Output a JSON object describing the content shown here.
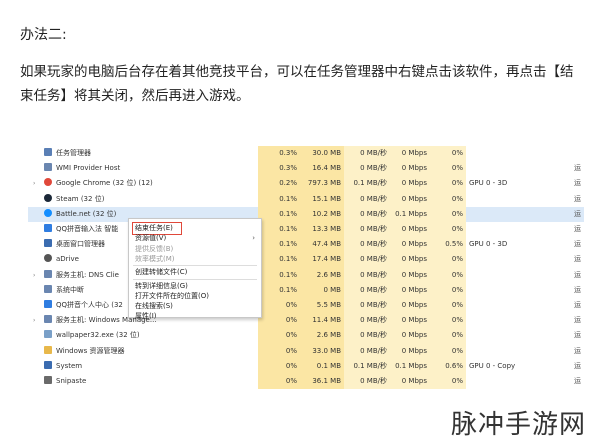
{
  "article": {
    "heading": "办法二:",
    "paragraph": "如果玩家的电脑后台存在着其他竞技平台，可以在任务管理器中右键点击该软件，再点击【结束任务】将其关闭，然后再进入游戏。"
  },
  "task_manager": {
    "rows": [
      {
        "name": "任务管理器",
        "cpu": "0.3%",
        "mem": "30.0 MB",
        "disk": "0 MB/秒",
        "net": "0 Mbps",
        "gpu": "0%",
        "engine": "",
        "tail": "",
        "icon": "gear-icon",
        "color": "#5a7fb5",
        "expand": false
      },
      {
        "name": "WMI Provider Host",
        "cpu": "0.3%",
        "mem": "16.4 MB",
        "disk": "0 MB/秒",
        "net": "0 Mbps",
        "gpu": "0%",
        "engine": "",
        "tail": "运",
        "icon": "service-icon",
        "color": "#6a86b0",
        "expand": false
      },
      {
        "name": "Google Chrome (32 位) (12)",
        "cpu": "0.2%",
        "mem": "797.3 MB",
        "disk": "0.1 MB/秒",
        "net": "0 Mbps",
        "gpu": "0%",
        "engine": "GPU 0 - 3D",
        "tail": "运",
        "icon": "chrome-icon",
        "color": "#e0483a",
        "expand": true
      },
      {
        "name": "Steam (32 位)",
        "cpu": "0.1%",
        "mem": "15.1 MB",
        "disk": "0 MB/秒",
        "net": "0 Mbps",
        "gpu": "0%",
        "engine": "",
        "tail": "运",
        "icon": "steam-icon",
        "color": "#1b2838",
        "expand": false
      },
      {
        "name": "Battle.net (32 位)",
        "cpu": "0.1%",
        "mem": "10.2 MB",
        "disk": "0 MB/秒",
        "net": "0.1 Mbps",
        "gpu": "0%",
        "engine": "",
        "tail": "运",
        "icon": "battlenet-icon",
        "color": "#148eff",
        "expand": false
      },
      {
        "name": "QQ拼音输入法 智能",
        "cpu": "0.1%",
        "mem": "13.3 MB",
        "disk": "0 MB/秒",
        "net": "0 Mbps",
        "gpu": "0%",
        "engine": "",
        "tail": "运",
        "icon": "qq-pinyin-icon",
        "color": "#2f7de1",
        "expand": false
      },
      {
        "name": "桌面窗口管理器",
        "cpu": "0.1%",
        "mem": "47.4 MB",
        "disk": "0 MB/秒",
        "net": "0 Mbps",
        "gpu": "0.5%",
        "engine": "GPU 0 - 3D",
        "tail": "运",
        "icon": "desktop-icon",
        "color": "#3b6cb0",
        "expand": false
      },
      {
        "name": "aDrive",
        "cpu": "0.1%",
        "mem": "17.4 MB",
        "disk": "0 MB/秒",
        "net": "0 Mbps",
        "gpu": "0%",
        "engine": "",
        "tail": "运",
        "icon": "cloud-icon",
        "color": "#555555",
        "expand": false
      },
      {
        "name": "服务主机: DNS Clie",
        "cpu": "0.1%",
        "mem": "2.6 MB",
        "disk": "0 MB/秒",
        "net": "0 Mbps",
        "gpu": "0%",
        "engine": "",
        "tail": "运",
        "icon": "service-icon",
        "color": "#6a86b0",
        "expand": true
      },
      {
        "name": "系统中断",
        "cpu": "0.1%",
        "mem": "0 MB",
        "disk": "0 MB/秒",
        "net": "0 Mbps",
        "gpu": "0%",
        "engine": "",
        "tail": "运",
        "icon": "system-icon",
        "color": "#6a86b0",
        "expand": false
      },
      {
        "name": "QQ拼音个人中心 (32",
        "cpu": "0%",
        "mem": "5.5 MB",
        "disk": "0 MB/秒",
        "net": "0 Mbps",
        "gpu": "0%",
        "engine": "",
        "tail": "运",
        "icon": "qq-pinyin-icon",
        "color": "#2f7de1",
        "expand": false
      },
      {
        "name": "服务主机: Windows Manage...",
        "cpu": "0%",
        "mem": "11.4 MB",
        "disk": "0 MB/秒",
        "net": "0 Mbps",
        "gpu": "0%",
        "engine": "",
        "tail": "运",
        "icon": "service-icon",
        "color": "#6a86b0",
        "expand": true
      },
      {
        "name": "wallpaper32.exe (32 位)",
        "cpu": "0%",
        "mem": "2.6 MB",
        "disk": "0 MB/秒",
        "net": "0 Mbps",
        "gpu": "0%",
        "engine": "",
        "tail": "运",
        "icon": "wallpaper-icon",
        "color": "#7aa0c8",
        "expand": false
      },
      {
        "name": "Windows 资源管理器",
        "cpu": "0%",
        "mem": "33.0 MB",
        "disk": "0 MB/秒",
        "net": "0 Mbps",
        "gpu": "0%",
        "engine": "",
        "tail": "运",
        "icon": "folder-icon",
        "color": "#e8b84a",
        "expand": false
      },
      {
        "name": "System",
        "cpu": "0%",
        "mem": "0.1 MB",
        "disk": "0.1 MB/秒",
        "net": "0.1 Mbps",
        "gpu": "0.6%",
        "engine": "GPU 0 - Copy",
        "tail": "运",
        "icon": "system-icon",
        "color": "#3b6cb0",
        "expand": false
      },
      {
        "name": "Snipaste",
        "cpu": "0%",
        "mem": "36.1 MB",
        "disk": "0 MB/秒",
        "net": "0 Mbps",
        "gpu": "0%",
        "engine": "",
        "tail": "运",
        "icon": "snipaste-icon",
        "color": "#6a6a6a",
        "expand": false
      }
    ],
    "context_menu": [
      {
        "label": "结束任务(E)",
        "highlight": true,
        "disabled": false
      },
      {
        "label": "资源值(V)",
        "highlight": false,
        "disabled": false,
        "submenu": true
      },
      {
        "label": "提供反馈(B)",
        "highlight": false,
        "disabled": true
      },
      {
        "label": "效率模式(M)",
        "highlight": false,
        "disabled": true
      },
      {
        "label": "创建转储文件(C)",
        "highlight": false,
        "disabled": false,
        "sep_before": true
      },
      {
        "label": "转到详细信息(G)",
        "highlight": false,
        "disabled": false,
        "sep_before": true
      },
      {
        "label": "打开文件所在的位置(O)",
        "highlight": false,
        "disabled": false
      },
      {
        "label": "在线搜索(S)",
        "highlight": false,
        "disabled": false
      },
      {
        "label": "属性(I)",
        "highlight": false,
        "disabled": false
      }
    ]
  },
  "watermark": "脉冲手游网"
}
